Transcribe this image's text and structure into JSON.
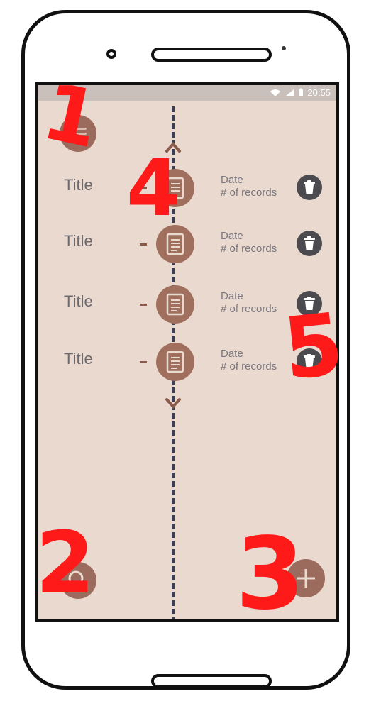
{
  "status_bar": {
    "time": "20:55"
  },
  "records": [
    {
      "title": "Title",
      "date": "Date",
      "count": "# of records"
    },
    {
      "title": "Title",
      "date": "Date",
      "count": "# of records"
    },
    {
      "title": "Title",
      "date": "Date",
      "count": "# of records"
    },
    {
      "title": "Title",
      "date": "Date",
      "count": "# of records"
    }
  ],
  "annotations": [
    "1",
    "2",
    "3",
    "4",
    "5"
  ],
  "colors": {
    "screen_background": "#ead9cf",
    "accent_brown": "#9b6b5d",
    "timeline": "#3b3f55",
    "trash": "#4b4b4f",
    "annotation_red": "#ff1a1a"
  },
  "icons": [
    "menu-icon",
    "chevron-up-icon",
    "chevron-down-icon",
    "document-icon",
    "trash-icon",
    "search-icon",
    "plus-icon",
    "wifi-icon",
    "signal-icon",
    "battery-icon"
  ]
}
